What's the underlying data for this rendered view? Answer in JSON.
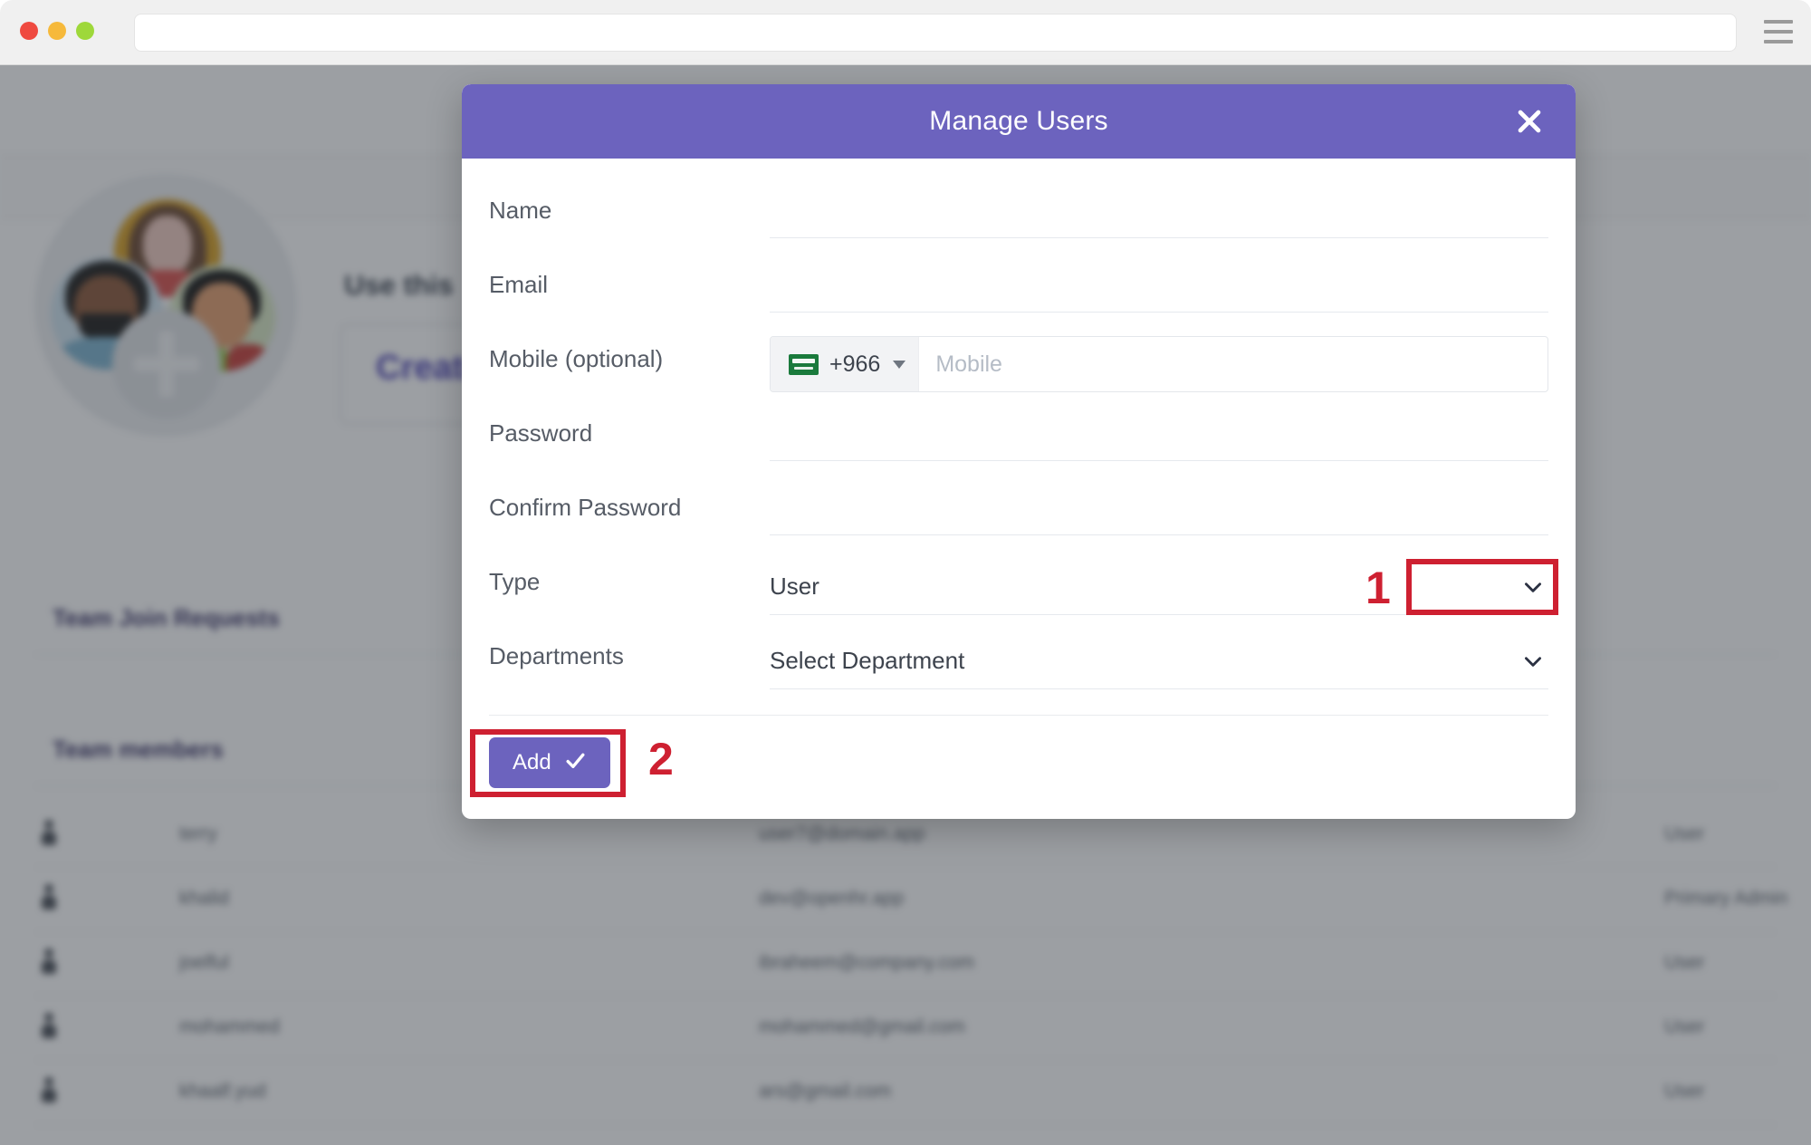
{
  "browser": {
    "url_value": "",
    "url_placeholder": "",
    "menu_icon": "hamburger-menu-icon",
    "traffic_lights": [
      "close-dot",
      "minimize-dot",
      "maximize-dot"
    ]
  },
  "background_page": {
    "hero_heading": "Use this",
    "create_label": "Create",
    "sections": [
      {
        "title": "Team Join Requests"
      },
      {
        "title": "Team members"
      }
    ],
    "table_rows": [
      {
        "name": "terry",
        "email": "user7@domain.app",
        "type": "User"
      },
      {
        "name": "khalid",
        "email": "dev@openhr.app",
        "type": "Primary Admin"
      },
      {
        "name": "joelful",
        "email": "ibraheem@company.com",
        "type": "User"
      },
      {
        "name": "mohammed",
        "email": "mohammed@gmail.com",
        "type": "User"
      },
      {
        "name": "khaalf.yud",
        "email": "ars@gmail.com",
        "type": "User"
      }
    ]
  },
  "modal": {
    "title": "Manage Users",
    "close_icon": "close-icon",
    "fields": {
      "name": {
        "label": "Name",
        "value": "",
        "placeholder": ""
      },
      "email": {
        "label": "Email",
        "value": "",
        "placeholder": ""
      },
      "mobile": {
        "label": "Mobile (optional)",
        "dial_code": "+966",
        "flag": "saudi-arabia-flag-icon",
        "value": "",
        "placeholder": "Mobile"
      },
      "password": {
        "label": "Password",
        "value": "",
        "placeholder": ""
      },
      "confirm_password": {
        "label": "Confirm Password",
        "value": "",
        "placeholder": ""
      },
      "type": {
        "label": "Type",
        "value": "User",
        "chevron": "chevron-down-icon"
      },
      "departments": {
        "label": "Departments",
        "value": "Select Department",
        "chevron": "chevron-down-icon"
      }
    },
    "footer": {
      "add_label": "Add",
      "add_icon": "check-icon"
    }
  },
  "annotations": [
    {
      "id": "1",
      "number": "1",
      "target": "type-dropdown-arrow"
    },
    {
      "id": "2",
      "number": "2",
      "target": "add-button"
    }
  ],
  "colors": {
    "modal_header_purple": "#6c63be",
    "primary_button_purple": "#6c63be",
    "annotation_red": "#ce2031",
    "section_title_purple": "#403a6b",
    "create_link_purple": "#4e44b7",
    "flag_green": "#1a7a3c"
  }
}
